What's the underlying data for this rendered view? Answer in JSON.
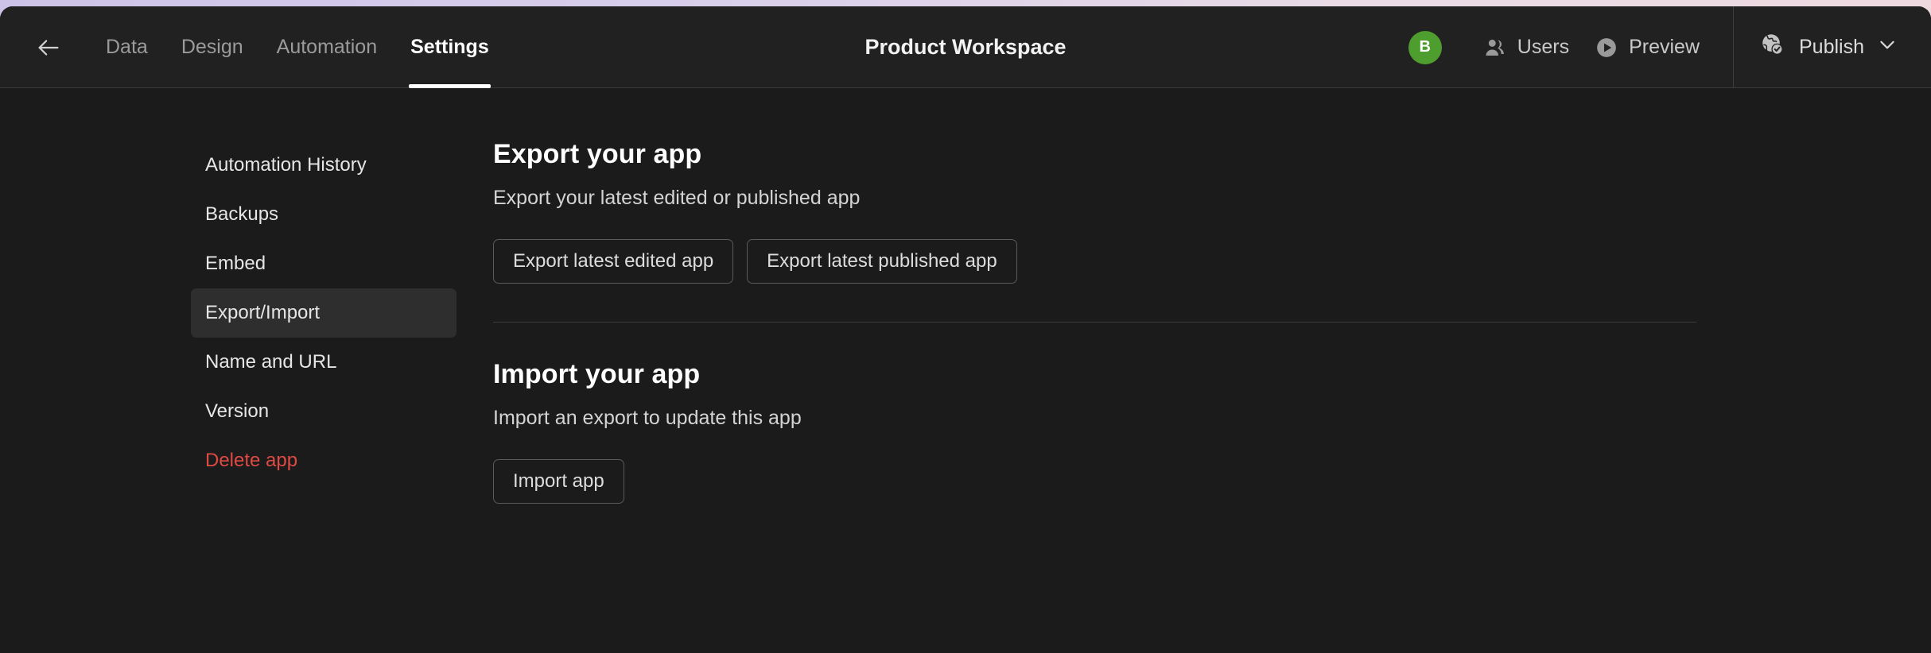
{
  "window": {
    "accent_strip_color": "#cdc3e8",
    "app_background": "#1b1b1b"
  },
  "header": {
    "back_icon": "arrow-left-icon",
    "title": "Product Workspace",
    "tabs": [
      {
        "label": "Data",
        "active": false
      },
      {
        "label": "Design",
        "active": false
      },
      {
        "label": "Automation",
        "active": false
      },
      {
        "label": "Settings",
        "active": true
      }
    ],
    "avatar": {
      "initial": "B",
      "color": "#4e9e2f"
    },
    "actions": [
      {
        "label": "Users",
        "icon": "users-icon"
      },
      {
        "label": "Preview",
        "icon": "play-circle-icon"
      }
    ],
    "publish": {
      "label": "Publish",
      "icon": "globe-check-icon",
      "chevron": "chevron-down-icon"
    }
  },
  "sidebar": {
    "items": [
      {
        "label": "Automation History",
        "active": false,
        "danger": false
      },
      {
        "label": "Backups",
        "active": false,
        "danger": false
      },
      {
        "label": "Embed",
        "active": false,
        "danger": false
      },
      {
        "label": "Export/Import",
        "active": true,
        "danger": false
      },
      {
        "label": "Name and URL",
        "active": false,
        "danger": false
      },
      {
        "label": "Version",
        "active": false,
        "danger": false
      },
      {
        "label": "Delete app",
        "active": false,
        "danger": true
      }
    ],
    "danger_color": "#e04a45",
    "active_background": "#2e2e2e"
  },
  "main": {
    "export": {
      "title": "Export your app",
      "subtitle": "Export your latest edited or published app",
      "buttons": [
        {
          "label": "Export latest edited app"
        },
        {
          "label": "Export latest published app"
        }
      ]
    },
    "import": {
      "title": "Import your app",
      "subtitle": "Import an export to update this app",
      "buttons": [
        {
          "label": "Import app"
        }
      ]
    }
  }
}
